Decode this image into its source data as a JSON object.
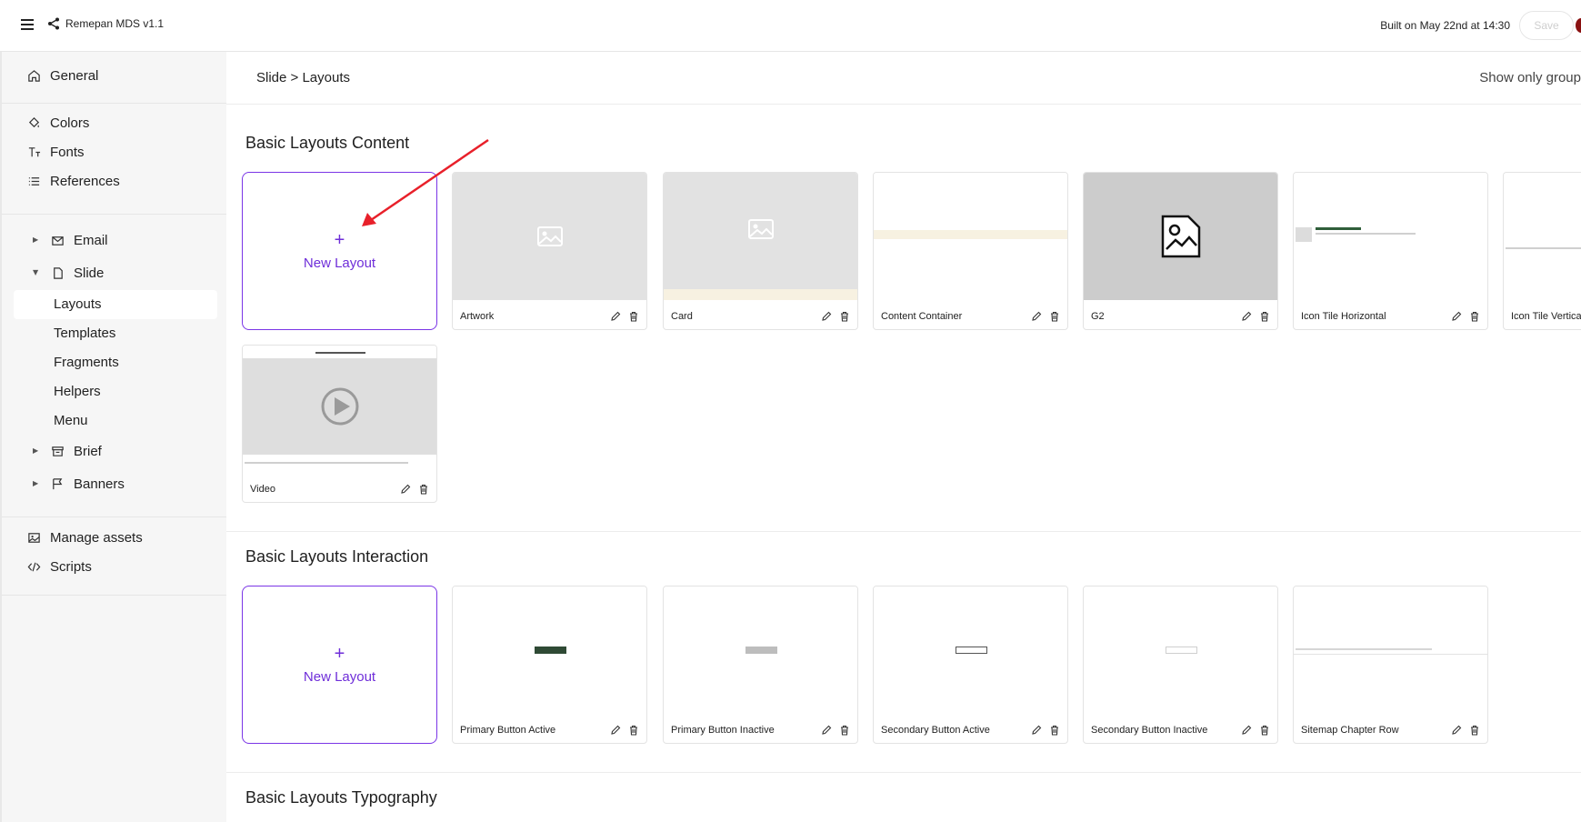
{
  "app": {
    "title": "Remepan MDS v1.1",
    "built": "Built on May 22nd at 14:30",
    "save_label": "Save"
  },
  "sidebar": {
    "general": "General",
    "colors": "Colors",
    "fonts": "Fonts",
    "references": "References",
    "email": "Email",
    "slide": "Slide",
    "layouts": "Layouts",
    "templates": "Templates",
    "fragments": "Fragments",
    "helpers": "Helpers",
    "menu": "Menu",
    "brief": "Brief",
    "banners": "Banners",
    "manage_assets": "Manage assets",
    "scripts": "Scripts"
  },
  "main": {
    "breadcrumb": "Slide > Layouts",
    "show_only": "Show only group",
    "new_layout": "New Layout",
    "sections": [
      {
        "title": "Basic Layouts Content",
        "cards": [
          "Artwork",
          "Card",
          "Content Container",
          "G2",
          "Icon Tile Horizontal",
          "Icon Tile Vertica",
          "Video"
        ]
      },
      {
        "title": "Basic Layouts Interaction",
        "cards": [
          "Primary Button Active",
          "Primary Button Inactive",
          "Secondary Button Active",
          "Secondary Button Inactive",
          "Sitemap Chapter Row"
        ]
      },
      {
        "title": "Basic Layouts Typography",
        "cards": []
      }
    ]
  },
  "colors": {
    "accent": "#6f2ed9",
    "annotation_arrow": "#e8202a"
  }
}
